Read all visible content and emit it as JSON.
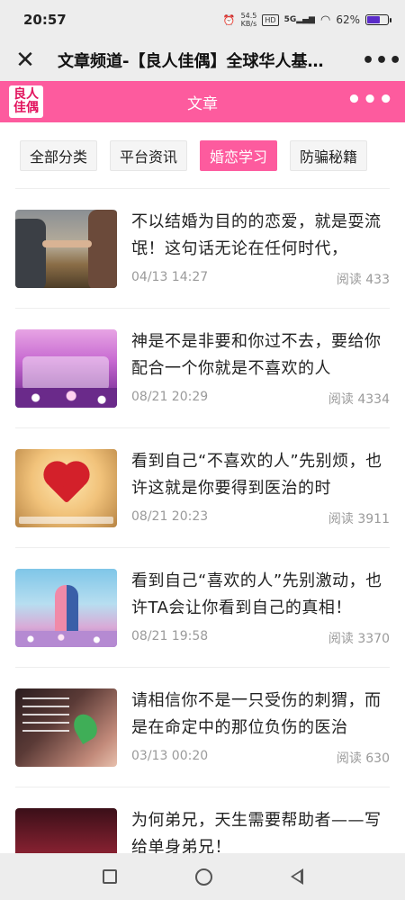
{
  "status_bar": {
    "time": "20:57",
    "network_speed_value": "54.5",
    "network_speed_unit": "KB/s",
    "hd_label": "HD",
    "signal_label": "5G",
    "battery_percent_text": "62%",
    "battery_level": 0.62
  },
  "title_bar": {
    "title": "文章频道-【良人佳偶】全球华人基…",
    "more_label": "•••"
  },
  "app_header": {
    "logo_line1": "良人",
    "logo_line2": "佳偶",
    "title": "文章",
    "more_label": "•••",
    "accent_color": "#fd5b9e"
  },
  "tabs": [
    {
      "label": "全部分类",
      "active": false
    },
    {
      "label": "平台资讯",
      "active": false
    },
    {
      "label": "婚恋学习",
      "active": true
    },
    {
      "label": "防骗秘籍",
      "active": false
    }
  ],
  "articles": [
    {
      "title": "不以结婚为目的的恋爱，就是耍流氓！这句话无论在任何时代，",
      "date": "04/13 14:27",
      "reads": "阅读 433"
    },
    {
      "title": "神是不是非要和你过不去，要给你配合一个你就是不喜欢的人",
      "date": "08/21 20:29",
      "reads": "阅读 4334"
    },
    {
      "title": "看到自己“不喜欢的人”先别烦，也许这就是你要得到医治的时",
      "date": "08/21 20:23",
      "reads": "阅读 3911"
    },
    {
      "title": "看到自己“喜欢的人”先别激动，也许TA会让你看到自己的真相！",
      "date": "08/21 19:58",
      "reads": "阅读 3370"
    },
    {
      "title": "请相信你不是一只受伤的刺猬，而是在命定中的那位负伤的医治",
      "date": "03/13 00:20",
      "reads": "阅读 630"
    },
    {
      "title": "为何弟兄，天生需要帮助者——写给单身弟兄！",
      "date": "",
      "reads": ""
    }
  ]
}
